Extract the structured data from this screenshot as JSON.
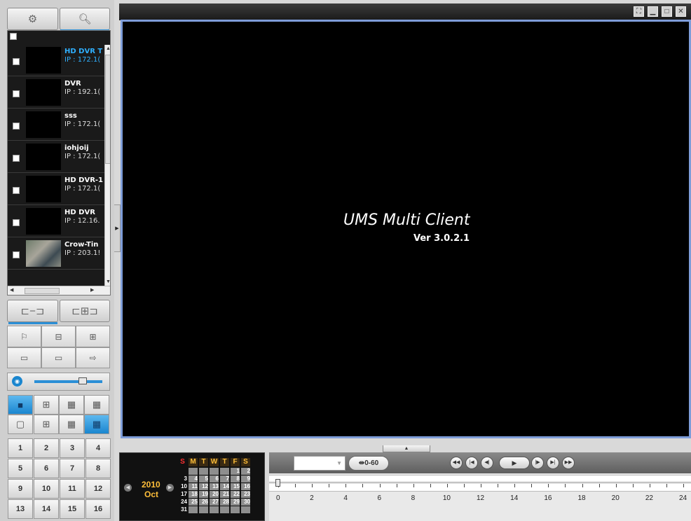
{
  "left_panel": {
    "tabs": [
      {
        "name": "settings-tab",
        "icon": "gear-icon"
      },
      {
        "name": "search-tab",
        "icon": "search-icon"
      }
    ],
    "devices": [
      {
        "name": "HD DVR T",
        "ip": "IP : 172.1(",
        "selected": true,
        "has_thumb": false
      },
      {
        "name": "DVR",
        "ip": "IP : 192.1(",
        "selected": false,
        "has_thumb": false
      },
      {
        "name": "sss",
        "ip": "IP : 172.1(",
        "selected": false,
        "has_thumb": false
      },
      {
        "name": "iohjoij",
        "ip": "IP : 172.1(",
        "selected": false,
        "has_thumb": false
      },
      {
        "name": "HD DVR-1",
        "ip": "IP : 172.1(",
        "selected": false,
        "has_thumb": false
      },
      {
        "name": "HD DVR",
        "ip": "IP : 12.16.",
        "selected": false,
        "has_thumb": false
      },
      {
        "name": "Crow-Tin",
        "ip": "IP : 203.1!",
        "selected": false,
        "has_thumb": true
      }
    ],
    "layout_buttons": [
      "1",
      "2",
      "3",
      "4",
      "5",
      "6",
      "7",
      "8",
      "9",
      "10",
      "11",
      "12",
      "13",
      "14",
      "15",
      "16"
    ]
  },
  "viewer": {
    "title": "UMS Multi Client",
    "version": "Ver 3.0.2.1"
  },
  "calendar": {
    "year": "2010",
    "month": "Oct",
    "headers": [
      "S",
      "M",
      "T",
      "W",
      "T",
      "F",
      "S"
    ],
    "rows": [
      [
        "",
        "",
        "",
        "",
        "",
        "1",
        "2"
      ],
      [
        "3",
        "4",
        "5",
        "6",
        "7",
        "8",
        "9"
      ],
      [
        "10",
        "11",
        "12",
        "13",
        "14",
        "15",
        "16"
      ],
      [
        "17",
        "18",
        "19",
        "20",
        "21",
        "22",
        "23"
      ],
      [
        "24",
        "25",
        "26",
        "27",
        "28",
        "29",
        "30"
      ],
      [
        "31",
        "",
        "",
        "",
        "",
        "",
        ""
      ]
    ]
  },
  "timeline": {
    "range_label": "0-60",
    "hours": [
      "0",
      "2",
      "4",
      "6",
      "8",
      "10",
      "12",
      "14",
      "16",
      "18",
      "20",
      "22",
      "24"
    ]
  },
  "colors": {
    "accent": "#2b8fd6",
    "viewer_border": "#7e9dd9",
    "calendar_accent": "#ffbf3a"
  }
}
